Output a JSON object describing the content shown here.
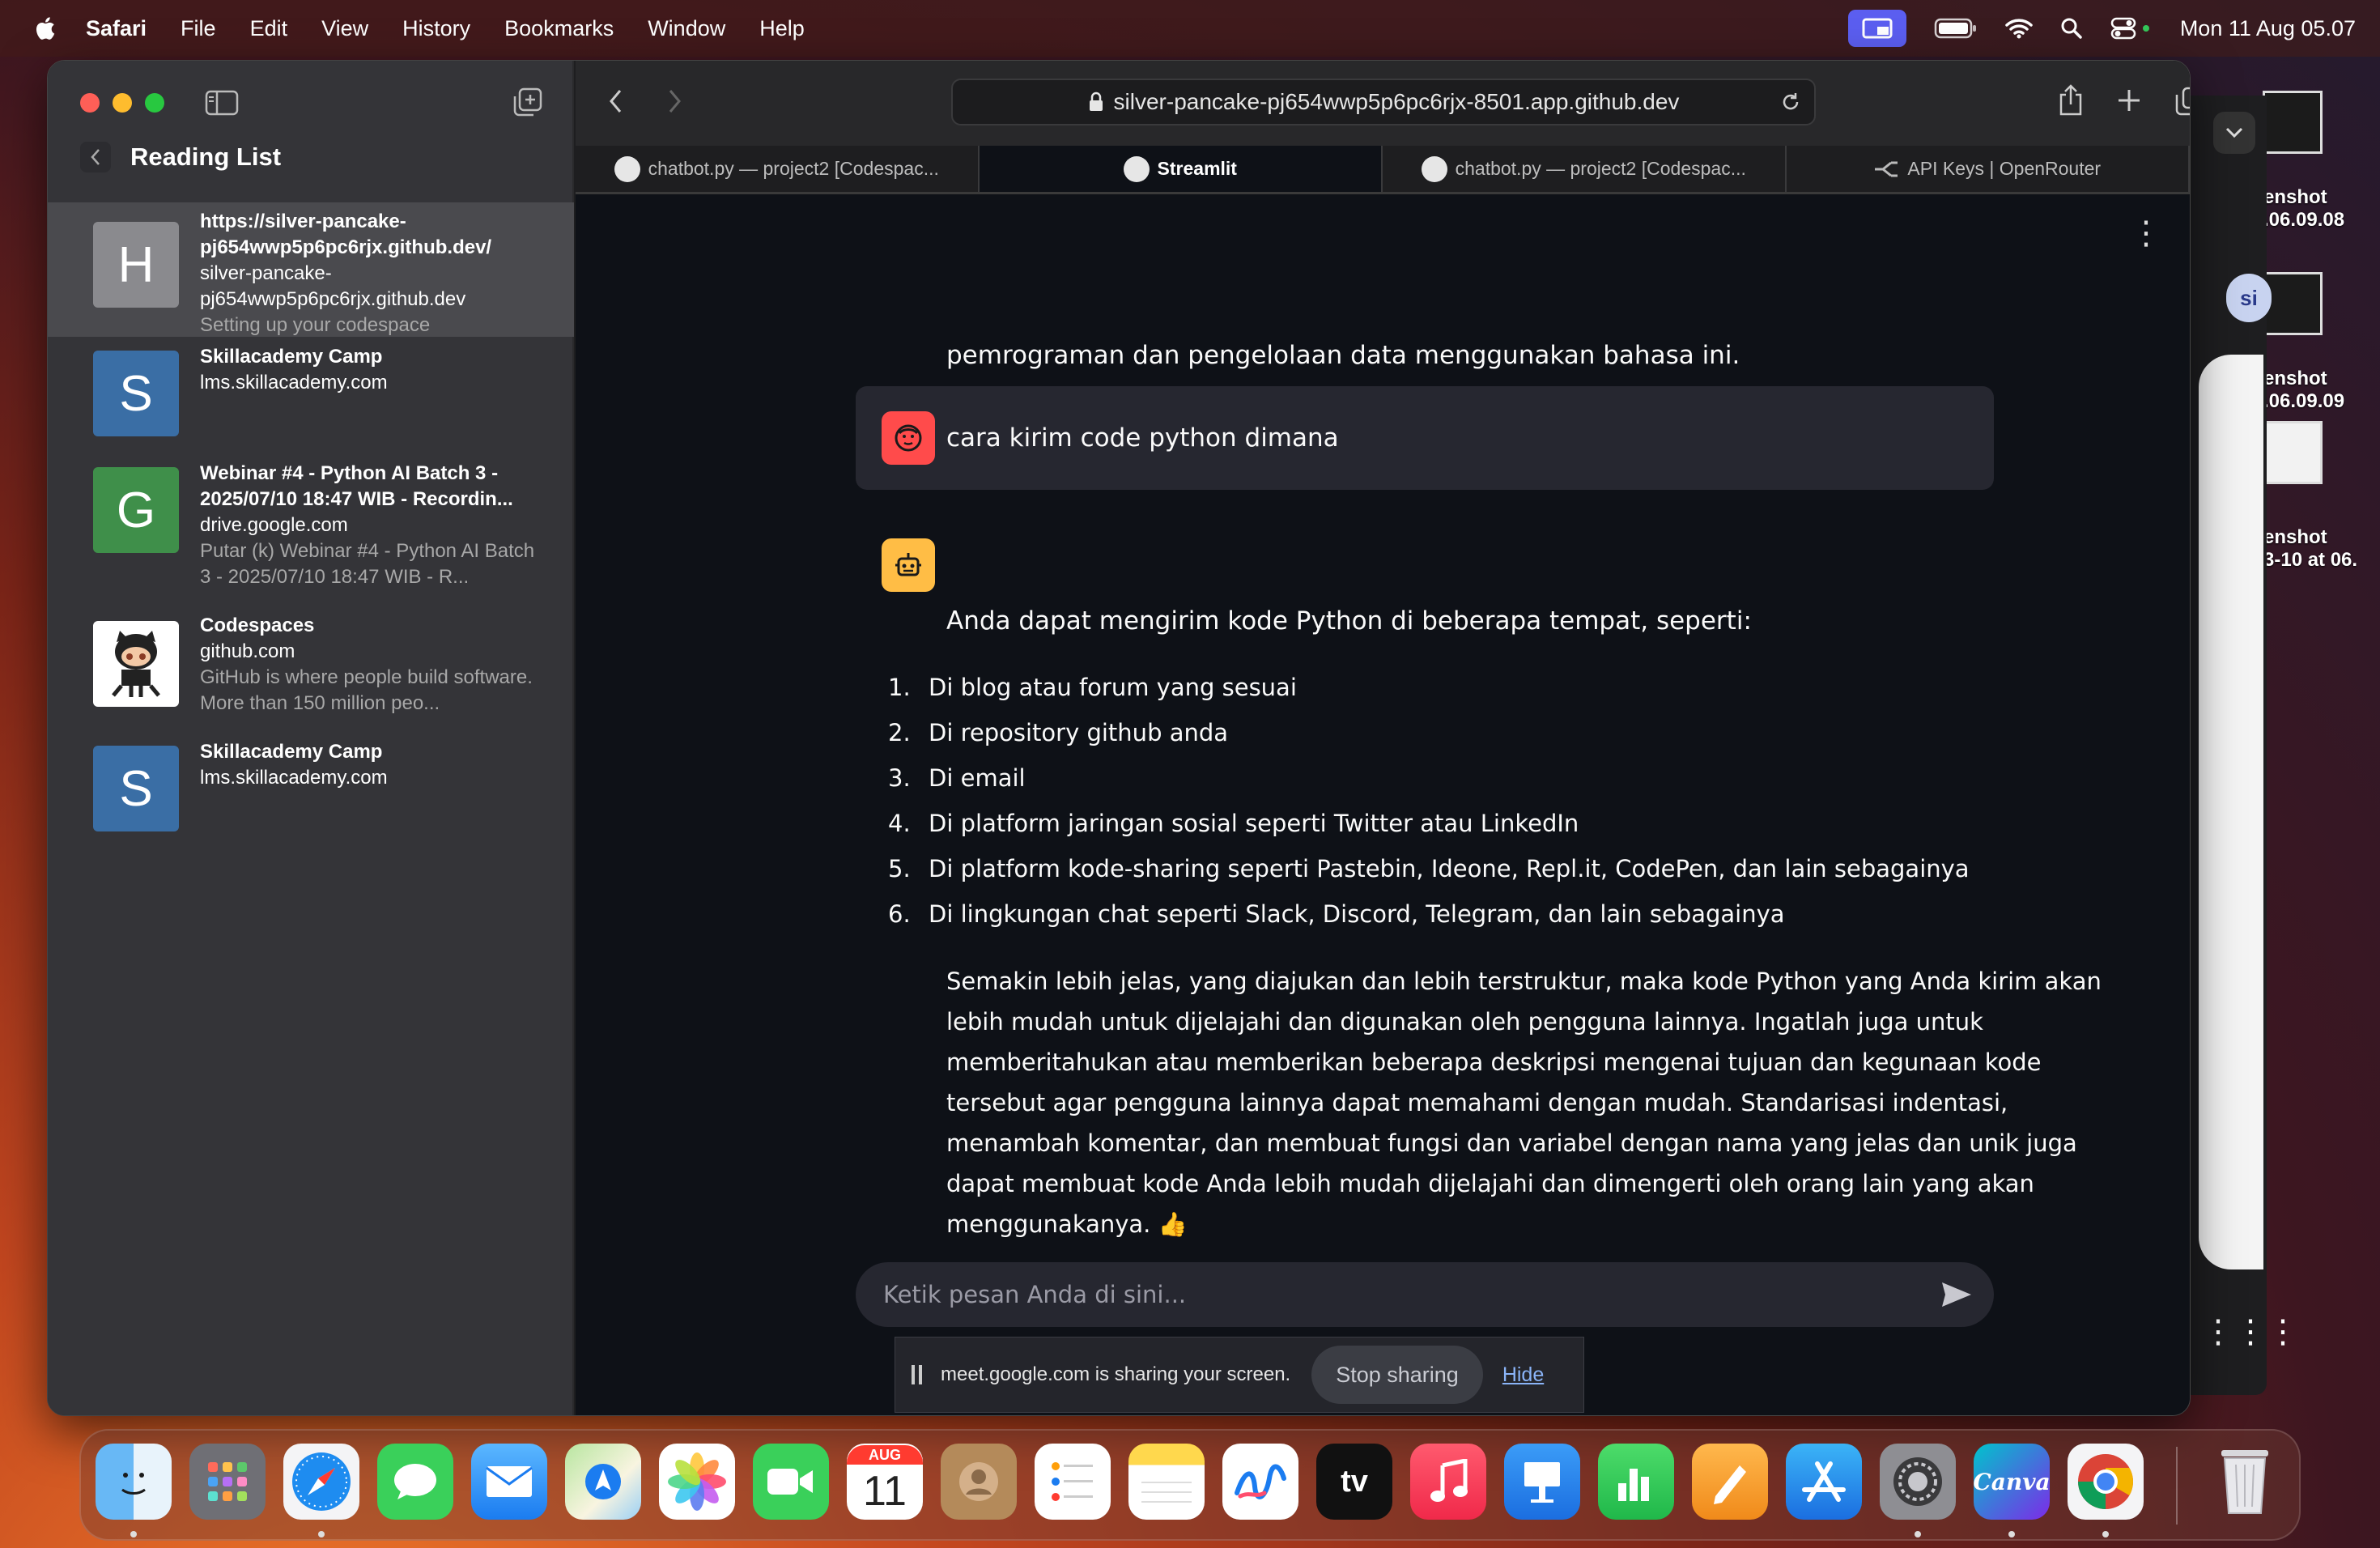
{
  "menubar": {
    "app": "Safari",
    "items": [
      "File",
      "Edit",
      "View",
      "History",
      "Bookmarks",
      "Window",
      "Help"
    ],
    "clock": "Mon 11 Aug  05.07"
  },
  "desktop": {
    "screenshots": [
      {
        "l1": "enshot",
        "l2": ".06.09.08"
      },
      {
        "l1": "enshot",
        "l2": ".06.09.09"
      },
      {
        "l1": "enshot",
        "l2": "3-10 at 06."
      }
    ],
    "bg_chip": "si"
  },
  "sidebar": {
    "title": "Reading List",
    "items": [
      {
        "letter": "H",
        "color": "#8a8a8e",
        "title": "https://silver-pancake-pj654wwp5p6pc6rjx.github.dev/",
        "url": "silver-pancake-pj654wwp5p6pc6rjx.github.dev",
        "desc": "Setting up your codespace"
      },
      {
        "letter": "S",
        "color": "#3a6ea5",
        "title": "Skillacademy Camp",
        "url": "lms.skillacademy.com",
        "desc": ""
      },
      {
        "letter": "G",
        "color": "#3f8f4a",
        "title": "Webinar #4 - Python AI Batch 3 - 2025/07/10 18:47 WIB - Recordin...",
        "url": "drive.google.com",
        "desc": "Putar (k) Webinar #4 - Python AI Batch 3 - 2025/07/10 18:47 WIB - R..."
      },
      {
        "letter": "",
        "color": "#ffffff",
        "title": "Codespaces",
        "url": "github.com",
        "desc": "GitHub is where people build software. More than 150 million peo..."
      },
      {
        "letter": "S",
        "color": "#3a6ea5",
        "title": "Skillacademy Camp",
        "url": "lms.skillacademy.com",
        "desc": ""
      }
    ]
  },
  "browser": {
    "url": "silver-pancake-pj654wwp5p6pc6rjx-8501.app.github.dev",
    "tabs": [
      {
        "label": "chatbot.py — project2 [Codespac...",
        "icon": "github-icon"
      },
      {
        "label": "Streamlit",
        "icon": "streamlit-icon"
      },
      {
        "label": "chatbot.py — project2 [Codespac...",
        "icon": "github-icon"
      },
      {
        "label": "API Keys | OpenRouter",
        "icon": "openrouter-icon"
      }
    ]
  },
  "chat": {
    "prev_tail": "pemrograman dan pengelolaan data menggunakan bahasa ini.",
    "user_message": "cara kirim code python dimana",
    "assistant_intro": "Anda dapat mengirim kode Python di beberapa tempat, seperti:",
    "list": [
      {
        "n": "1.",
        "text": "Di blog atau forum yang sesuai"
      },
      {
        "n": "2.",
        "text": "Di repository github anda"
      },
      {
        "n": "3.",
        "text": "Di email"
      },
      {
        "n": "4.",
        "text": "Di platform jaringan sosial seperti Twitter atau LinkedIn"
      },
      {
        "n": "5.",
        "text": "Di platform kode-sharing seperti Pastebin, Ideone, Repl.it, CodePen, dan lain sebagainya"
      },
      {
        "n": "6.",
        "text": "Di lingkungan chat seperti Slack, Discord, Telegram, dan lain sebagainya"
      }
    ],
    "para_lines": [
      "Semakin lebih jelas, yang diajukan dan lebih terstruktur, maka kode Python yang Anda kirim akan",
      "lebih mudah untuk dijelajahi dan digunakan oleh pengguna lainnya. Ingatlah juga untuk",
      "memberitahukan atau memberikan beberapa deskripsi mengenai tujuan dan kegunaan kode",
      "tersebut agar pengguna lainnya dapat memahami dengan mudah. Standarisasi indentasi,",
      "menambah komentar, dan membuat fungsi dan variabel dengan nama yang jelas dan unik juga",
      "dapat membuat kode Anda lebih mudah dijelajahi dan dimengerti oleh orang lain yang akan",
      "menggunakanya. 👍"
    ],
    "input_placeholder": "Ketik pesan Anda di sini..."
  },
  "sharebar": {
    "text": "meet.google.com is sharing your screen.",
    "stop": "Stop sharing",
    "hide": "Hide"
  },
  "dock": {
    "calendar_month": "AUG",
    "calendar_day": "11",
    "tv_label": "tv",
    "canva_label": "Canva",
    "apps": [
      "finder",
      "launchpad",
      "safari",
      "messages",
      "mail",
      "maps",
      "photos",
      "facetime",
      "contacts",
      "calendar",
      "reminders",
      "notes",
      "freeform",
      "tv",
      "music",
      "keynote",
      "numbers",
      "pages",
      "app-store",
      "system-settings",
      "canva",
      "chrome",
      "trash"
    ]
  }
}
